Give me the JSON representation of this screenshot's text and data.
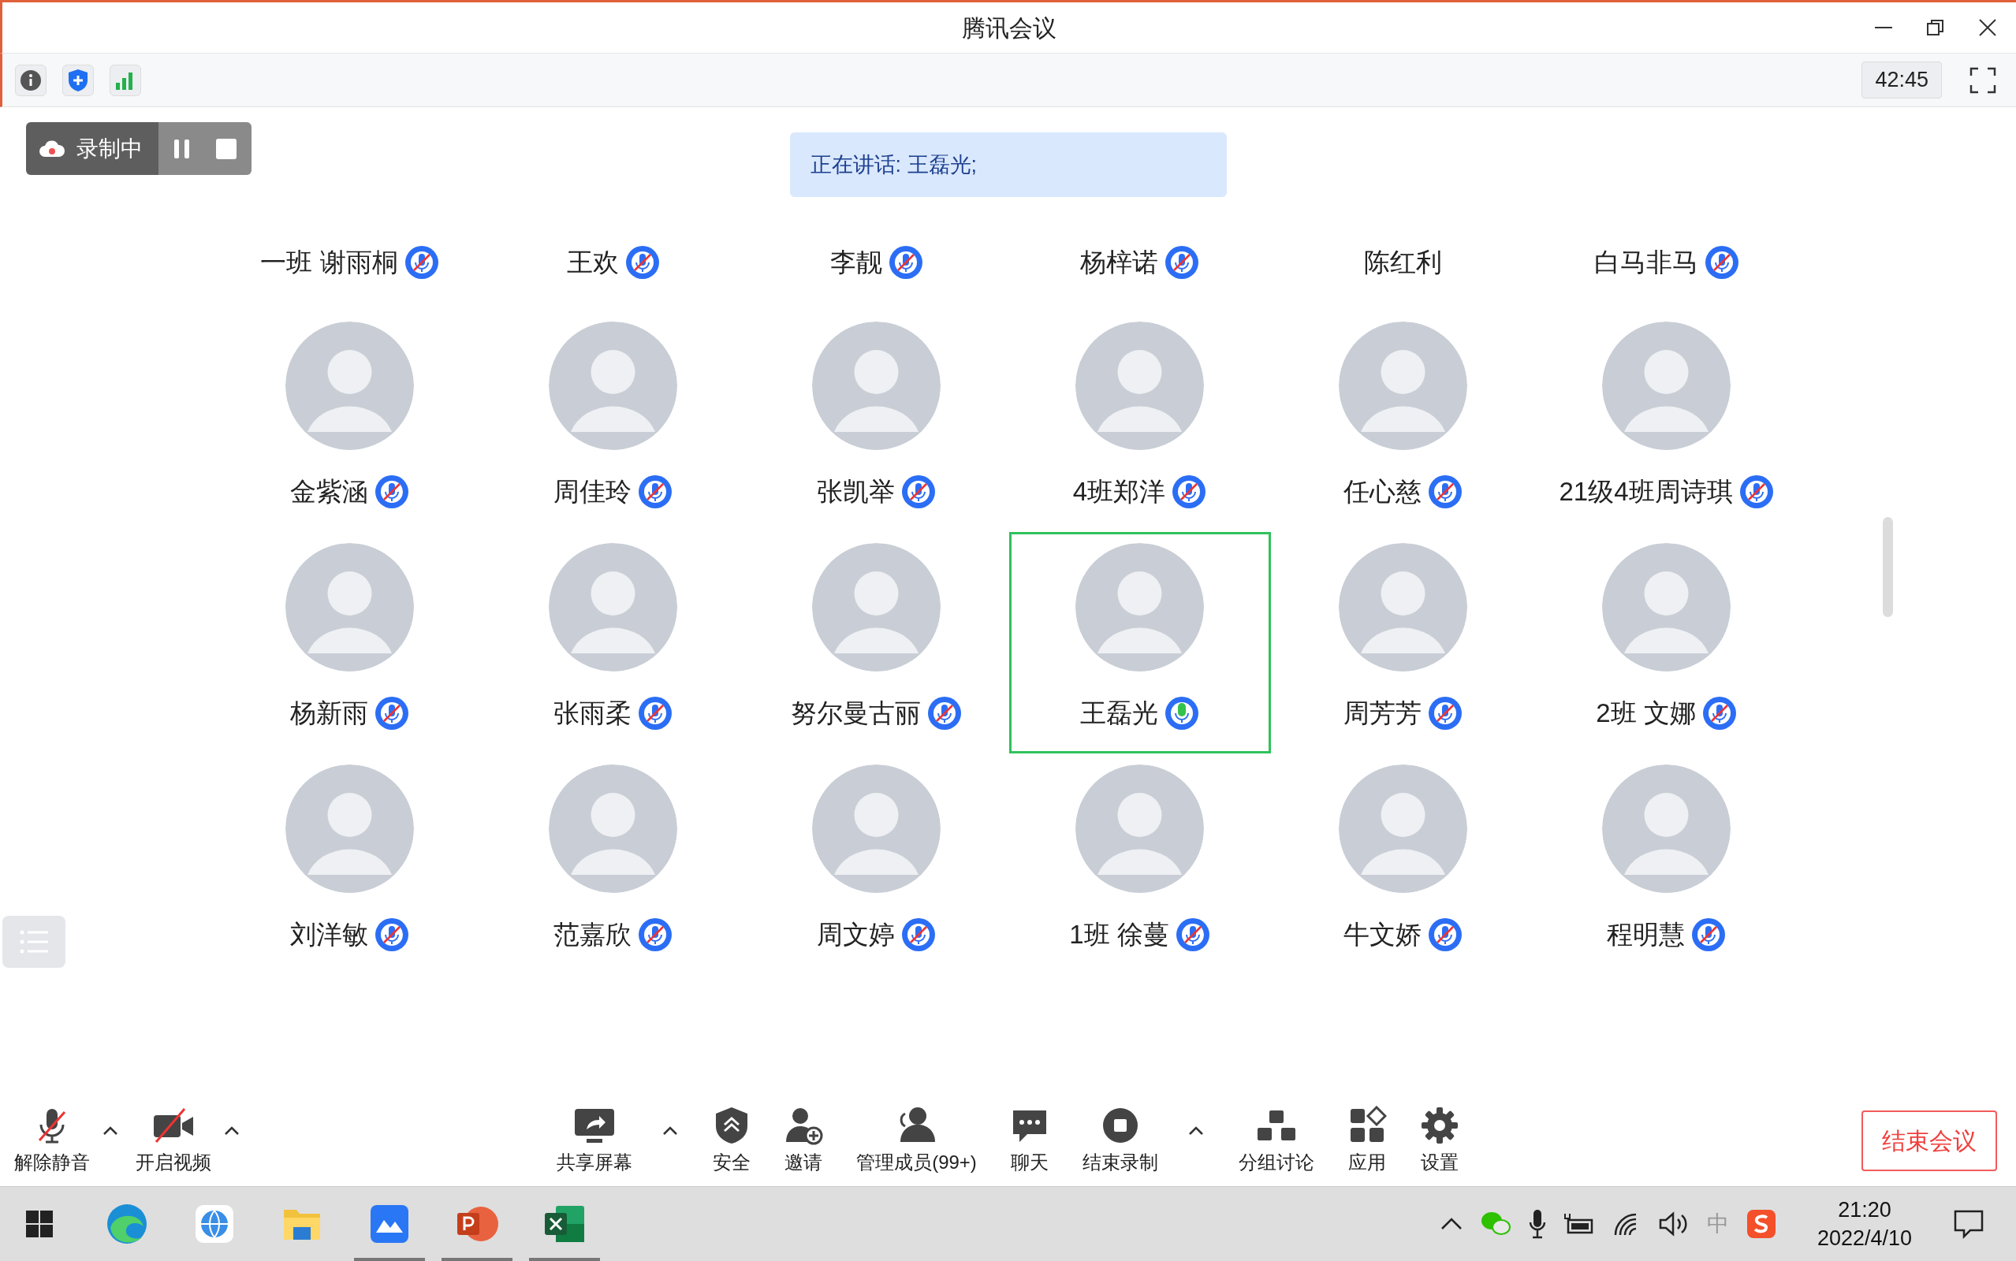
{
  "window": {
    "title": "腾讯会议"
  },
  "info_bar": {
    "timer": "42:45"
  },
  "recording": {
    "label": "录制中"
  },
  "speaking_banner": "正在讲话: 王磊光;",
  "header_row": [
    {
      "name": "一班 谢雨桐",
      "kind": "muted"
    },
    {
      "name": "王欢",
      "kind": "muted"
    },
    {
      "name": "李靓",
      "kind": "muted"
    },
    {
      "name": "杨梓诺",
      "kind": "muted"
    },
    {
      "name": "陈红利",
      "kind": "plain"
    },
    {
      "name": "白马非马",
      "kind": "muted"
    }
  ],
  "participants": [
    {
      "name": "金紫涵",
      "kind": "muted",
      "highlighted": false
    },
    {
      "name": "周佳玲",
      "kind": "muted",
      "highlighted": false
    },
    {
      "name": "张凯举",
      "kind": "muted",
      "highlighted": false
    },
    {
      "name": "4班郑洋",
      "kind": "muted",
      "highlighted": false
    },
    {
      "name": "任心慈",
      "kind": "muted",
      "highlighted": false
    },
    {
      "name": "21级4班周诗琪",
      "kind": "muted",
      "highlighted": false
    },
    {
      "name": "杨新雨",
      "kind": "muted",
      "highlighted": false
    },
    {
      "name": "张雨柔",
      "kind": "muted",
      "highlighted": false
    },
    {
      "name": "努尔曼古丽",
      "kind": "muted",
      "highlighted": false
    },
    {
      "name": "王磊光",
      "kind": "talking",
      "highlighted": true
    },
    {
      "name": "周芳芳",
      "kind": "muted",
      "highlighted": false
    },
    {
      "name": "2班 文娜",
      "kind": "muted",
      "highlighted": false
    },
    {
      "name": "刘洋敏",
      "kind": "muted",
      "highlighted": false
    },
    {
      "name": "范嘉欣",
      "kind": "muted",
      "highlighted": false
    },
    {
      "name": "周文婷",
      "kind": "muted",
      "highlighted": false
    },
    {
      "name": "1班 徐蔓",
      "kind": "muted",
      "highlighted": false
    },
    {
      "name": "牛文娇",
      "kind": "muted",
      "highlighted": false
    },
    {
      "name": "程明慧",
      "kind": "muted",
      "highlighted": false
    }
  ],
  "toolbar_left": [
    {
      "label": "解除静音",
      "kind": "mic",
      "menu": true
    },
    {
      "label": "开启视频",
      "kind": "video",
      "menu": true
    }
  ],
  "toolbar_center": [
    {
      "label": "共享屏幕",
      "kind": "share",
      "menu": true
    },
    {
      "label": "安全",
      "kind": "security",
      "menu": false
    },
    {
      "label": "邀请",
      "kind": "invite",
      "menu": false
    },
    {
      "label": "管理成员(99+)",
      "kind": "members",
      "menu": false
    },
    {
      "label": "聊天",
      "kind": "chat",
      "menu": false
    },
    {
      "label": "结束录制",
      "kind": "stop",
      "menu": true
    },
    {
      "label": "分组讨论",
      "kind": "groups",
      "menu": false
    },
    {
      "label": "应用",
      "kind": "apps",
      "menu": false
    },
    {
      "label": "设置",
      "kind": "settings",
      "menu": false
    }
  ],
  "end_button": "结束会议",
  "taskbar": {
    "apps": [
      {
        "kind": "windows",
        "running": false
      },
      {
        "kind": "edge",
        "running": false
      },
      {
        "kind": "globe",
        "running": false
      },
      {
        "kind": "folder",
        "running": false
      },
      {
        "kind": "meeting",
        "running": true
      },
      {
        "kind": "powerpoint",
        "running": true
      },
      {
        "kind": "excel",
        "running": true
      }
    ],
    "ime": "中",
    "time": "21:20",
    "date": "2022/4/10"
  }
}
